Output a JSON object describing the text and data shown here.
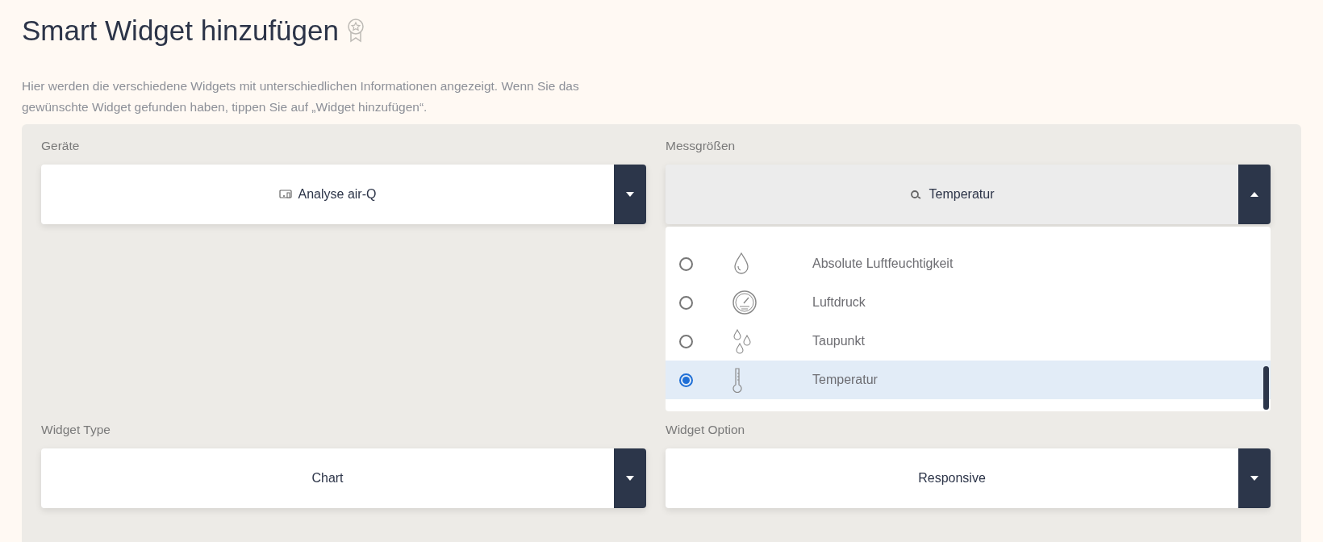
{
  "title": "Smart Widget hinzufügen",
  "description": "Hier werden die verschiedene Widgets mit unterschiedlichen Informationen angezeigt. Wenn Sie das gewünschte Widget gefunden haben, tippen Sie auf „Widget hinzufügen“.",
  "fields": [
    {
      "label": "Geräte",
      "value": "Analyse air-Q",
      "kind": "device",
      "expanded": false
    },
    {
      "label": "Messgrößen",
      "value": "Temperatur",
      "kind": "measure",
      "expanded": true,
      "options": [
        {
          "label": "Absolute Luftfeuchtigkeit",
          "kind": "humidity",
          "selected": false
        },
        {
          "label": "Luftdruck",
          "kind": "pressure",
          "selected": false
        },
        {
          "label": "Taupunkt",
          "kind": "dewpoint",
          "selected": false
        },
        {
          "label": "Temperatur",
          "kind": "temperature",
          "selected": true
        }
      ]
    },
    {
      "label": "Widget Type",
      "value": "Chart",
      "kind": "plain",
      "expanded": false
    },
    {
      "label": "Widget Option",
      "value": "Responsive",
      "kind": "plain",
      "expanded": false
    }
  ]
}
